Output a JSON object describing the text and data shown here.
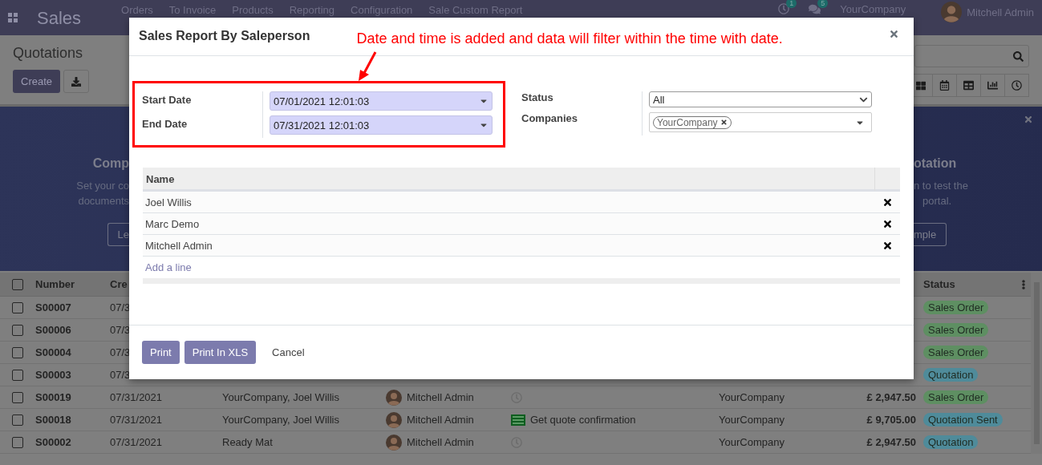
{
  "navbar": {
    "app_name": "Sales",
    "menu": [
      "Orders",
      "To Invoice",
      "Products",
      "Reporting",
      "Configuration",
      "Sale Custom Report"
    ],
    "activity_count": "1",
    "message_count": "5",
    "company": "YourCompany",
    "user": "Mitchell Admin"
  },
  "control_panel": {
    "title": "Quotations",
    "create_button": "Create"
  },
  "banner": {
    "left": {
      "heading": "Comp",
      "lines": [
        "Set your co",
        "documents"
      ],
      "button": "Le"
    },
    "right": {
      "heading": "otation",
      "lines": [
        "n to test the",
        "portal."
      ],
      "button": "mple"
    }
  },
  "list": {
    "header_checked": false,
    "columns": [
      {
        "label": "Number"
      },
      {
        "label": "Cre"
      },
      {
        "label": "Status"
      }
    ],
    "rows": [
      {
        "checked": false,
        "number": "S00007",
        "date": "07/3",
        "status": {
          "label": "Sales Order",
          "color": "#5e8f62"
        }
      },
      {
        "checked": false,
        "number": "S00006",
        "date": "07/3",
        "status": {
          "label": "Sales Order",
          "color": "#5e8f62"
        }
      },
      {
        "checked": false,
        "number": "S00004",
        "date": "07/3",
        "status": {
          "label": "Sales Order",
          "color": "#5e8f62"
        }
      },
      {
        "checked": false,
        "number": "S00003",
        "date": "07/3",
        "status": {
          "label": "Quotation",
          "color": "#4f8b9a"
        }
      },
      {
        "checked": false,
        "number": "S00019",
        "date": "07/31/2021",
        "customer": "YourCompany, Joel Willis",
        "salesperson": "Mitchell Admin",
        "activity": {
          "kind": "clock"
        },
        "company": "YourCompany",
        "amount": "£ 2,947.50",
        "status": {
          "label": "Sales Order",
          "color": "#5e8f62"
        }
      },
      {
        "checked": false,
        "number": "S00018",
        "date": "07/31/2021",
        "customer": "YourCompany, Joel Willis",
        "salesperson": "Mitchell Admin",
        "activity": {
          "kind": "todo",
          "text": "Get quote confirmation"
        },
        "company": "YourCompany",
        "amount": "£ 9,705.00",
        "status": {
          "label": "Quotation Sent",
          "color": "#4f8b9a"
        }
      },
      {
        "checked": false,
        "number": "S00002",
        "date": "07/31/2021",
        "customer": "Ready Mat",
        "salesperson": "Mitchell Admin",
        "activity": {
          "kind": "clock"
        },
        "company": "YourCompany",
        "amount": "£ 2,947.50",
        "status": {
          "label": "Quotation",
          "color": "#4f8b9a"
        }
      }
    ]
  },
  "dialog": {
    "title": "Sales Report By Saleperson",
    "annotation": "Date and time is added and data will filter within the time with date.",
    "dates": [
      {
        "label": "Start Date",
        "value": "07/01/2021 12:01:03"
      },
      {
        "label": "End Date",
        "value": "07/31/2021 12:01:03"
      }
    ],
    "status": {
      "label": "Status",
      "value": "All"
    },
    "companies": {
      "label": "Companies",
      "tags": [
        "YourCompany"
      ]
    },
    "salespersons": {
      "column": "Name",
      "rows": [
        "Joel Willis",
        "Marc Demo",
        "Mitchell Admin"
      ],
      "add_line": "Add a line"
    },
    "buttons": [
      {
        "label": "Print",
        "kind": "primary"
      },
      {
        "label": "Print In XLS",
        "kind": "primary"
      },
      {
        "label": "Cancel",
        "kind": "link"
      }
    ]
  }
}
